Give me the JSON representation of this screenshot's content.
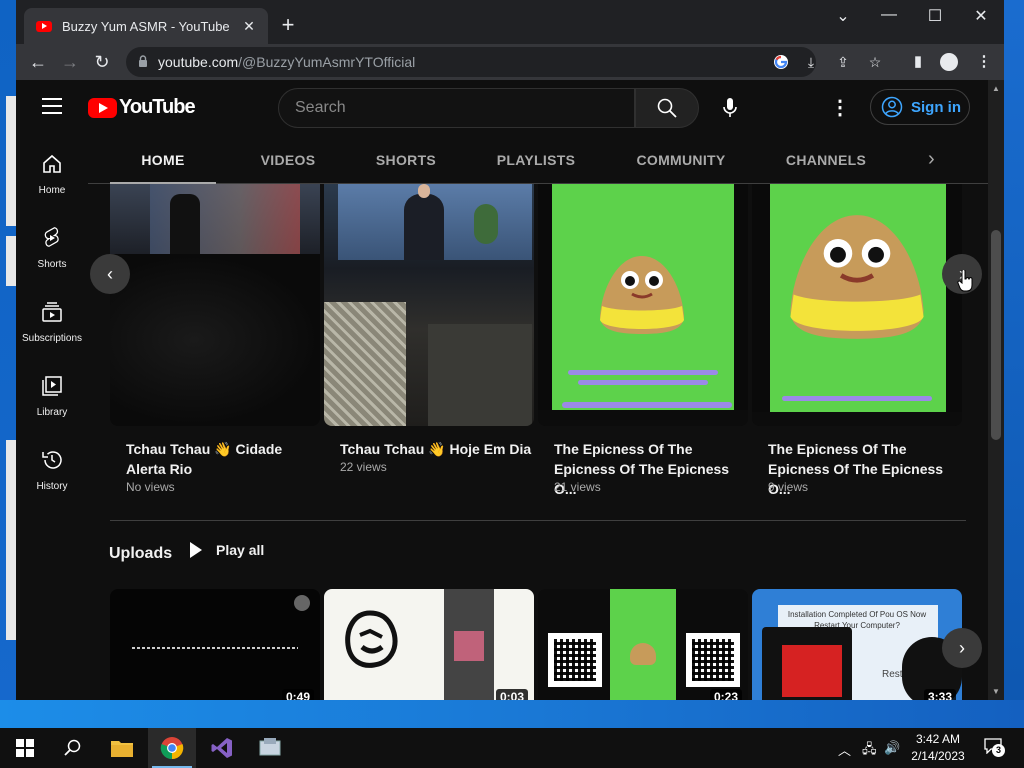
{
  "browser": {
    "tab_title": "Buzzy Yum ASMR - YouTube",
    "tab_close": "✕",
    "new_tab": "+",
    "url_host": "youtube.com",
    "url_path": "/@BuzzyYumAsmrYTOfficial",
    "win_minimize": "⌄",
    "win_min2": "—",
    "win_max": "☐",
    "win_close": "✕"
  },
  "youtube": {
    "logo_text": "YouTube",
    "search_placeholder": "Search",
    "signin_label": "Sign in",
    "guide": [
      {
        "label": "Home",
        "icon": "home-icon"
      },
      {
        "label": "Shorts",
        "icon": "shorts-icon"
      },
      {
        "label": "Subscriptions",
        "icon": "subscriptions-icon"
      },
      {
        "label": "Library",
        "icon": "library-icon"
      },
      {
        "label": "History",
        "icon": "history-icon"
      }
    ],
    "tabs": [
      "HOME",
      "VIDEOS",
      "SHORTS",
      "PLAYLISTS",
      "COMMUNITY",
      "CHANNELS"
    ],
    "featured": [
      {
        "title_line1": "Tchau Tchau 👋 Cidade",
        "title_line2": "Alerta Rio",
        "meta": "No views"
      },
      {
        "title_line1": "Tchau Tchau 👋 Hoje Em Dia",
        "title_line2": "",
        "meta": "22 views"
      },
      {
        "title_line1": "The Epicness Of The",
        "title_line2": "Epicness Of The Epicness O...",
        "meta": "21 views"
      },
      {
        "title_line1": "The Epicness Of The",
        "title_line2": "Epicness Of The Epicness O...",
        "meta": "9 views"
      }
    ],
    "uploads_title": "Uploads",
    "play_all": "Play all",
    "uploads": [
      {
        "duration": "0:49"
      },
      {
        "duration": "0:03"
      },
      {
        "duration": "0:23"
      },
      {
        "duration": "3:33",
        "overlay_text": "Installation Completed Of Pou OS Now Restart Your Computer?",
        "restart": "Restart"
      }
    ]
  },
  "taskbar": {
    "time": "3:42 AM",
    "date": "2/14/2023",
    "notifications": "3"
  },
  "colors": {
    "youtube_red": "#ff0000",
    "signin_blue": "#3ea6ff",
    "page_bg": "#0f0f0f",
    "pou_green": "#5dd24b"
  }
}
